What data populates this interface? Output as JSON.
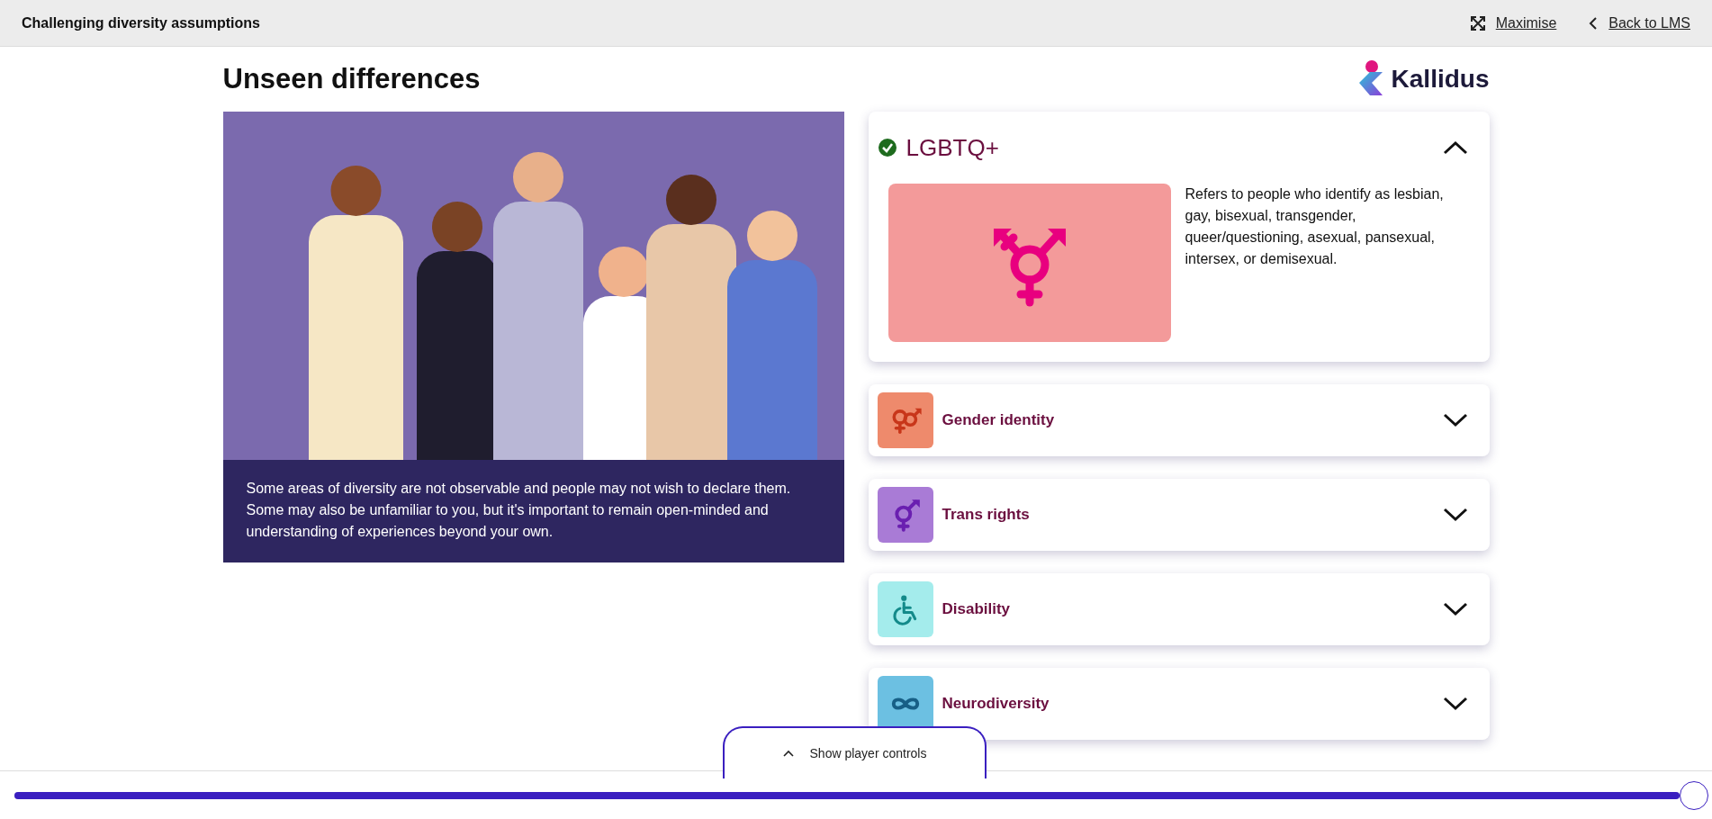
{
  "top_bar": {
    "title": "Challenging diversity assumptions",
    "maximise_link": "Maximise",
    "back_link": "Back to LMS"
  },
  "page": {
    "heading": "Unseen differences",
    "logo_text": "Kallidus"
  },
  "illustration": {
    "caption": "Some areas of diversity are not observable and people may not wish to declare them. Some may also be unfamiliar to you, but it's important to remain open-minded and understanding of experiences beyond your own."
  },
  "accordion": [
    {
      "title": "LGBTQ+",
      "expanded": true,
      "completed": true,
      "color": "#f39a9a",
      "body": "Refers to people who identify as lesbian, gay, bisexual, transgender, queer/questioning, asexual, pansexual, intersex, or demisexual."
    },
    {
      "title": "Gender identity",
      "expanded": false,
      "completed": false,
      "color": "#ee8a6c"
    },
    {
      "title": "Trans rights",
      "expanded": false,
      "completed": false,
      "color": "#a97bd6"
    },
    {
      "title": "Disability",
      "expanded": false,
      "completed": false,
      "color": "#a4ecec"
    },
    {
      "title": "Neurodiversity",
      "expanded": false,
      "completed": false,
      "color": "#6cc0e2"
    }
  ],
  "player": {
    "toggle_label": "Show player controls",
    "progress": {
      "level": 1
    }
  }
}
